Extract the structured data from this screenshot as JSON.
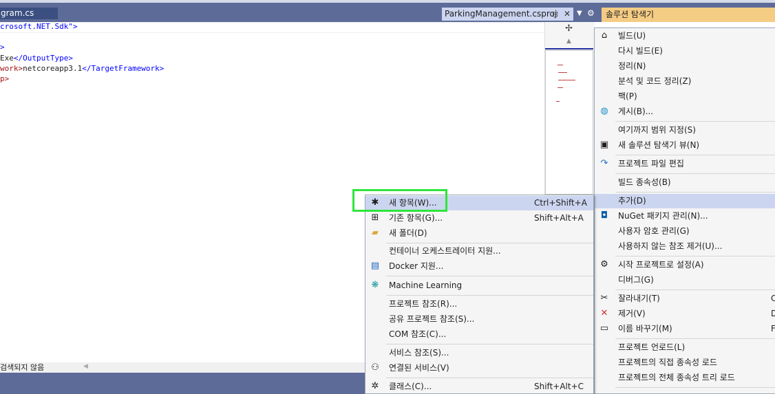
{
  "tabs": {
    "left_tab_label": "gram.cs",
    "active_tab_label": "ParkingManagement.csproj",
    "pin_glyph": "⊟",
    "close_glyph": "✕"
  },
  "solution_explorer": {
    "title": "솔루션 탐색기"
  },
  "editor": {
    "lines": [
      {
        "parts": [
          "crosoft.NET.Sdk\">"
        ]
      },
      {
        "parts": [
          ""
        ]
      },
      {
        "parts": [
          ">"
        ]
      },
      {
        "parts": [
          "Exe",
          "</OutputType>"
        ]
      },
      {
        "parts": [
          "work>",
          "netcoreapp3.1",
          "</TargetFramework>"
        ]
      },
      {
        "parts": [
          "p>"
        ]
      }
    ]
  },
  "status": {
    "search_text": "검색되지 않음"
  },
  "context_menu": {
    "items": [
      {
        "label": "빌드(U)",
        "icon": "build-icon"
      },
      {
        "label": "다시 빌드(E)"
      },
      {
        "label": "정리(N)"
      },
      {
        "label": "분석 및 코드 정리(Z)"
      },
      {
        "label": "팩(P)"
      },
      {
        "label": "게시(B)...",
        "icon": "globe-icon"
      },
      {
        "label": "여기까지 범위 지정(S)"
      },
      {
        "label": "새 솔루션 탐색기 뷰(N)",
        "icon": "new-view-icon"
      },
      {
        "label": "프로젝트 파일 편집",
        "icon": "edit-arrow-icon"
      },
      {
        "label": "빌드 종속성(B)"
      },
      {
        "label": "추가(D)",
        "highlighted": true
      },
      {
        "label": "NuGet 패키지 관리(N)...",
        "icon": "nuget-icon"
      },
      {
        "label": "사용자 암호 관리(G)"
      },
      {
        "label": "사용하지 않는 참조 제거(U)..."
      },
      {
        "label": "시작 프로젝트로 설정(A)",
        "icon": "gear-icon"
      },
      {
        "label": "디버그(G)"
      },
      {
        "label": "잘라내기(T)",
        "icon": "scissors-icon",
        "shortcut": "C"
      },
      {
        "label": "제거(V)",
        "icon": "delete-x-icon",
        "shortcut": "D"
      },
      {
        "label": "이름 바꾸기(M)",
        "icon": "rename-icon",
        "shortcut": "F"
      },
      {
        "label": "프로젝트 언로드(L)"
      },
      {
        "label": "프로젝트의 직접 종속성 로드"
      },
      {
        "label": "프로젝트의 전체 종속성 트리 로드"
      }
    ]
  },
  "add_submenu": {
    "items": [
      {
        "label": "새 항목(W)...",
        "shortcut": "Ctrl+Shift+A",
        "icon": "new-item-icon",
        "highlighted": true
      },
      {
        "label": "기존 항목(G)...",
        "shortcut": "Shift+Alt+A",
        "icon": "existing-item-icon"
      },
      {
        "label": "새 폴더(D)",
        "icon": "folder-icon"
      },
      {
        "label": "컨테이너 오케스트레이터 지원..."
      },
      {
        "label": "Docker 지원...",
        "icon": "docker-icon"
      },
      {
        "label": "Machine Learning",
        "icon": "machine-learning-icon"
      },
      {
        "label": "프로젝트 참조(R)..."
      },
      {
        "label": "공유 프로젝트 참조(S)..."
      },
      {
        "label": "COM 참조(C)..."
      },
      {
        "label": "서비스 참조(S)..."
      },
      {
        "label": "연결된 서비스(V)",
        "icon": "connected-service-icon"
      },
      {
        "label": "클래스(C)...",
        "shortcut": "Shift+Alt+C",
        "icon": "class-icon"
      }
    ]
  },
  "colors": {
    "title_bar": "#5d6b99",
    "solution_header": "#f5cc84",
    "menu_highlight": "#ccd5f0",
    "annotation_box": "#2ee63a"
  }
}
